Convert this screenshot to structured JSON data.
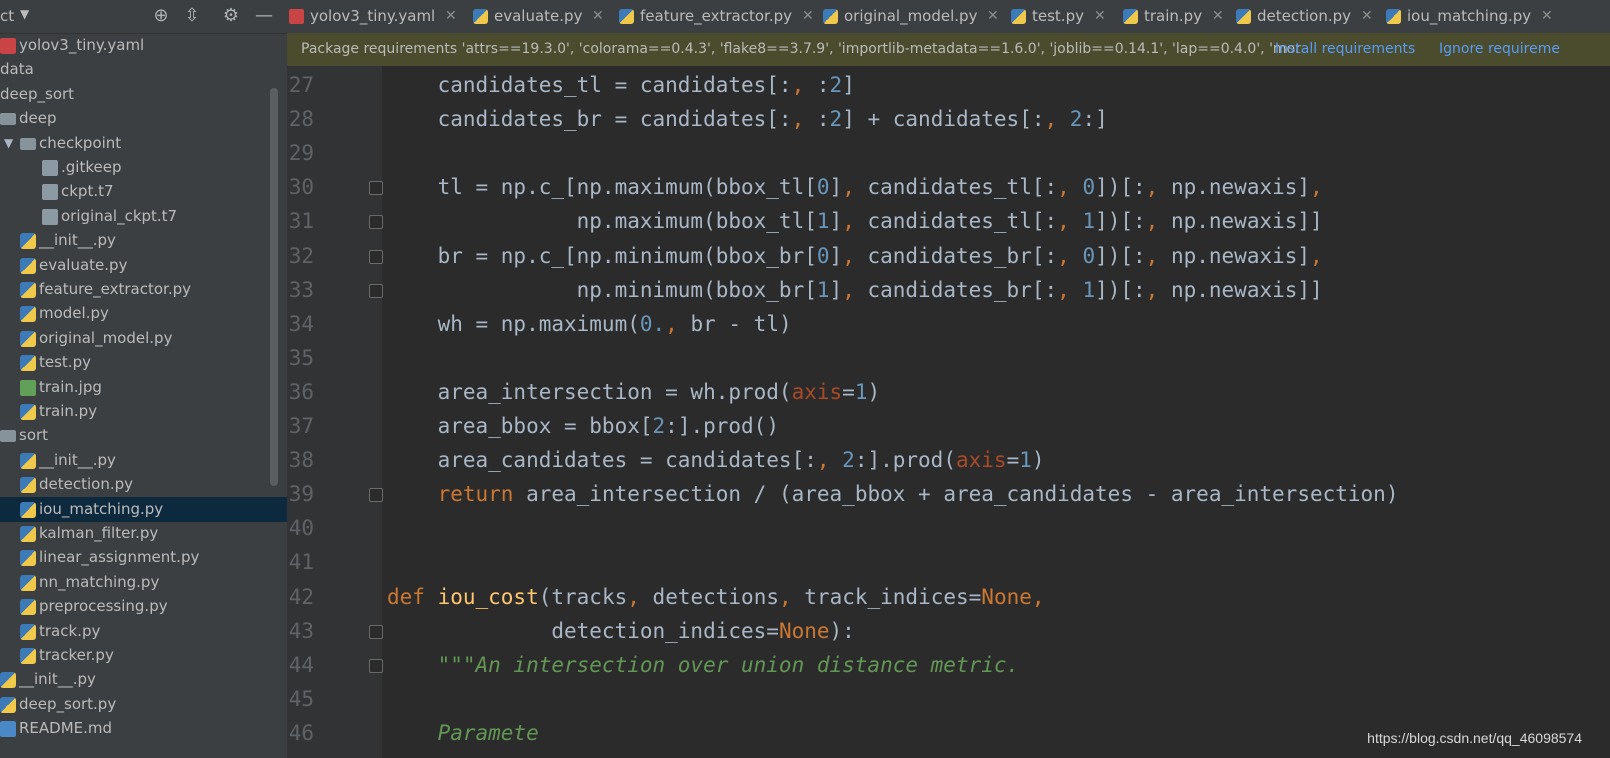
{
  "project_header": {
    "title": "ct",
    "dropdown": "▼"
  },
  "tree": [
    {
      "label": "yolov3_tiny.yaml",
      "icon": "yaml",
      "indent": 0,
      "arrow": ""
    },
    {
      "label": "data",
      "icon": "none",
      "indent": 0,
      "arrow": ""
    },
    {
      "label": "deep_sort",
      "icon": "none",
      "indent": 0,
      "arrow": ""
    },
    {
      "label": "deep",
      "icon": "folder",
      "indent": 1,
      "arrow": ""
    },
    {
      "label": "checkpoint",
      "icon": "folder",
      "indent": 2,
      "arrow": "▼"
    },
    {
      "label": ".gitkeep",
      "icon": "file",
      "indent": 3,
      "arrow": ""
    },
    {
      "label": "ckpt.t7",
      "icon": "file",
      "indent": 3,
      "arrow": ""
    },
    {
      "label": "original_ckpt.t7",
      "icon": "file",
      "indent": 3,
      "arrow": ""
    },
    {
      "label": "__init__.py",
      "icon": "py",
      "indent": 2,
      "arrow": ""
    },
    {
      "label": "evaluate.py",
      "icon": "py",
      "indent": 2,
      "arrow": ""
    },
    {
      "label": "feature_extractor.py",
      "icon": "py",
      "indent": 2,
      "arrow": ""
    },
    {
      "label": "model.py",
      "icon": "py",
      "indent": 2,
      "arrow": ""
    },
    {
      "label": "original_model.py",
      "icon": "py",
      "indent": 2,
      "arrow": ""
    },
    {
      "label": "test.py",
      "icon": "py",
      "indent": 2,
      "arrow": ""
    },
    {
      "label": "train.jpg",
      "icon": "jpg",
      "indent": 2,
      "arrow": ""
    },
    {
      "label": "train.py",
      "icon": "py",
      "indent": 2,
      "arrow": ""
    },
    {
      "label": "sort",
      "icon": "folder",
      "indent": 1,
      "arrow": ""
    },
    {
      "label": "__init__.py",
      "icon": "py",
      "indent": 2,
      "arrow": ""
    },
    {
      "label": "detection.py",
      "icon": "py",
      "indent": 2,
      "arrow": ""
    },
    {
      "label": "iou_matching.py",
      "icon": "py",
      "indent": 2,
      "arrow": "",
      "selected": true
    },
    {
      "label": "kalman_filter.py",
      "icon": "py",
      "indent": 2,
      "arrow": ""
    },
    {
      "label": "linear_assignment.py",
      "icon": "py",
      "indent": 2,
      "arrow": ""
    },
    {
      "label": "nn_matching.py",
      "icon": "py",
      "indent": 2,
      "arrow": ""
    },
    {
      "label": "preprocessing.py",
      "icon": "py",
      "indent": 2,
      "arrow": ""
    },
    {
      "label": "track.py",
      "icon": "py",
      "indent": 2,
      "arrow": ""
    },
    {
      "label": "tracker.py",
      "icon": "py",
      "indent": 2,
      "arrow": ""
    },
    {
      "label": "__init__.py",
      "icon": "py",
      "indent": 0,
      "arrow": ""
    },
    {
      "label": "deep_sort.py",
      "icon": "py",
      "indent": 0,
      "arrow": ""
    },
    {
      "label": "README.md",
      "icon": "md",
      "indent": 0,
      "arrow": ""
    }
  ],
  "tabs": [
    {
      "label": "yolov3_tiny.yaml",
      "icon": "yaml"
    },
    {
      "label": "evaluate.py",
      "icon": "py"
    },
    {
      "label": "feature_extractor.py",
      "icon": "py"
    },
    {
      "label": "original_model.py",
      "icon": "py"
    },
    {
      "label": "test.py",
      "icon": "py"
    },
    {
      "label": "train.py",
      "icon": "py"
    },
    {
      "label": "detection.py",
      "icon": "py"
    },
    {
      "label": "iou_matching.py",
      "icon": "py",
      "active": true
    }
  ],
  "notification": {
    "message": "Package requirements 'attrs==19.3.0', 'colorama==0.4.3', 'flake8==3.7.9', 'importlib-metadata==1.6.0', 'joblib==0.14.1', 'lap==0.4.0', 'mor",
    "install_label": "Install requirements",
    "ignore_label": "Ignore requireme"
  },
  "code": [
    {
      "n": "27",
      "fold": false,
      "tokens": [
        [
          "t",
          "    candidates_tl = candidates[:"
        ],
        [
          "kw",
          ", "
        ],
        [
          "t",
          ":"
        ],
        [
          "num",
          "2"
        ],
        [
          "t",
          "]"
        ]
      ]
    },
    {
      "n": "28",
      "fold": false,
      "tokens": [
        [
          "t",
          "    candidates_br = candidates[:"
        ],
        [
          "kw",
          ", "
        ],
        [
          "t",
          ":"
        ],
        [
          "num",
          "2"
        ],
        [
          "t",
          "] + candidates[:"
        ],
        [
          "kw",
          ", "
        ],
        [
          "num",
          "2"
        ],
        [
          "t",
          ":]"
        ]
      ]
    },
    {
      "n": "29",
      "fold": false,
      "tokens": []
    },
    {
      "n": "30",
      "fold": true,
      "tokens": [
        [
          "t",
          "    tl = np.c_[np.maximum(bbox_tl["
        ],
        [
          "num",
          "0"
        ],
        [
          "t",
          "]"
        ],
        [
          "kw",
          ", "
        ],
        [
          "t",
          "candidates_tl[:"
        ],
        [
          "kw",
          ", "
        ],
        [
          "num",
          "0"
        ],
        [
          "t",
          "])[:"
        ],
        [
          "kw",
          ", "
        ],
        [
          "t",
          "np.newaxis]"
        ],
        [
          "kw",
          ","
        ]
      ]
    },
    {
      "n": "31",
      "fold": true,
      "tokens": [
        [
          "t",
          "               np.maximum(bbox_tl["
        ],
        [
          "num",
          "1"
        ],
        [
          "t",
          "]"
        ],
        [
          "kw",
          ", "
        ],
        [
          "t",
          "candidates_tl[:"
        ],
        [
          "kw",
          ", "
        ],
        [
          "num",
          "1"
        ],
        [
          "t",
          "])[:"
        ],
        [
          "kw",
          ", "
        ],
        [
          "t",
          "np.newaxis]]"
        ]
      ]
    },
    {
      "n": "32",
      "fold": true,
      "tokens": [
        [
          "t",
          "    br = np.c_[np.minimum(bbox_br["
        ],
        [
          "num",
          "0"
        ],
        [
          "t",
          "]"
        ],
        [
          "kw",
          ", "
        ],
        [
          "t",
          "candidates_br[:"
        ],
        [
          "kw",
          ", "
        ],
        [
          "num",
          "0"
        ],
        [
          "t",
          "])[:"
        ],
        [
          "kw",
          ", "
        ],
        [
          "t",
          "np.newaxis]"
        ],
        [
          "kw",
          ","
        ]
      ]
    },
    {
      "n": "33",
      "fold": true,
      "tokens": [
        [
          "t",
          "               np.minimum(bbox_br["
        ],
        [
          "num",
          "1"
        ],
        [
          "t",
          "]"
        ],
        [
          "kw",
          ", "
        ],
        [
          "t",
          "candidates_br[:"
        ],
        [
          "kw",
          ", "
        ],
        [
          "num",
          "1"
        ],
        [
          "t",
          "])[:"
        ],
        [
          "kw",
          ", "
        ],
        [
          "t",
          "np.newaxis]]"
        ]
      ]
    },
    {
      "n": "34",
      "fold": false,
      "tokens": [
        [
          "t",
          "    wh = np.maximum("
        ],
        [
          "num",
          "0."
        ],
        [
          "kw",
          ", "
        ],
        [
          "t",
          "br - tl)"
        ]
      ]
    },
    {
      "n": "35",
      "fold": false,
      "tokens": []
    },
    {
      "n": "36",
      "fold": false,
      "tokens": [
        [
          "t",
          "    area_intersection = wh.prod("
        ],
        [
          "param",
          "axis"
        ],
        [
          "t",
          "="
        ],
        [
          "num",
          "1"
        ],
        [
          "t",
          ")"
        ]
      ]
    },
    {
      "n": "37",
      "fold": false,
      "tokens": [
        [
          "t",
          "    area_bbox = bbox["
        ],
        [
          "num",
          "2"
        ],
        [
          "t",
          ":].prod()"
        ]
      ]
    },
    {
      "n": "38",
      "fold": false,
      "tokens": [
        [
          "t",
          "    area_candidates = candidates[:"
        ],
        [
          "kw",
          ", "
        ],
        [
          "num",
          "2"
        ],
        [
          "t",
          ":].prod("
        ],
        [
          "param",
          "axis"
        ],
        [
          "t",
          "="
        ],
        [
          "num",
          "1"
        ],
        [
          "t",
          ")"
        ]
      ]
    },
    {
      "n": "39",
      "fold": true,
      "tokens": [
        [
          "t",
          "    "
        ],
        [
          "kw",
          "return "
        ],
        [
          "t",
          "area_intersection / (area_bbox + area_candidates - area_intersection)"
        ]
      ]
    },
    {
      "n": "40",
      "fold": false,
      "tokens": []
    },
    {
      "n": "41",
      "fold": false,
      "tokens": []
    },
    {
      "n": "42",
      "fold": false,
      "tokens": [
        [
          "kw",
          "def "
        ],
        [
          "fn",
          "iou_cost"
        ],
        [
          "t",
          "(tracks"
        ],
        [
          "kw",
          ", "
        ],
        [
          "t",
          "detections"
        ],
        [
          "kw",
          ", "
        ],
        [
          "t",
          "track_indices="
        ],
        [
          "kw",
          "None,"
        ]
      ]
    },
    {
      "n": "43",
      "fold": true,
      "tokens": [
        [
          "t",
          "             detection_indices="
        ],
        [
          "kw",
          "None"
        ],
        [
          "t",
          "):"
        ]
      ]
    },
    {
      "n": "44",
      "fold": true,
      "tokens": [
        [
          "doc",
          "    \"\"\"An intersection over union distance metric."
        ]
      ]
    },
    {
      "n": "45",
      "fold": false,
      "tokens": []
    },
    {
      "n": "46",
      "fold": false,
      "tokens": [
        [
          "doc",
          "    Paramete"
        ]
      ]
    }
  ],
  "watermark": "https://blog.csdn.net/qq_46098574"
}
